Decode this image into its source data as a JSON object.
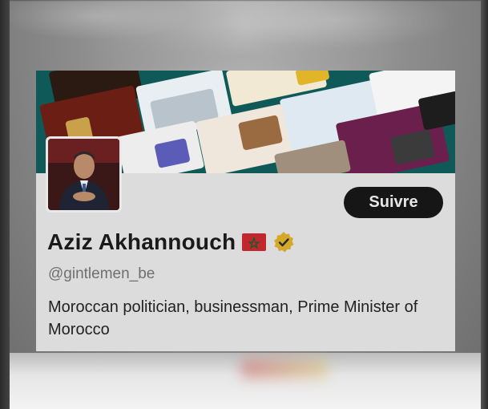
{
  "profile": {
    "display_name": "Aziz Akhannouch",
    "handle": "@gintlemen_be",
    "bio": "Moroccan politician, businessman, Prime Minister of Morocco",
    "flag_icon": "morocco-flag-icon",
    "verified_icon": "verified-badge-icon",
    "verified_color": "#d4a82a"
  },
  "actions": {
    "follow_label": "Suivre"
  },
  "colors": {
    "banner_bg": "#0f5a58",
    "card_bg": "#dcdcdc",
    "button_bg": "#161616",
    "flag_red": "#c1272d",
    "flag_green": "#006233"
  }
}
